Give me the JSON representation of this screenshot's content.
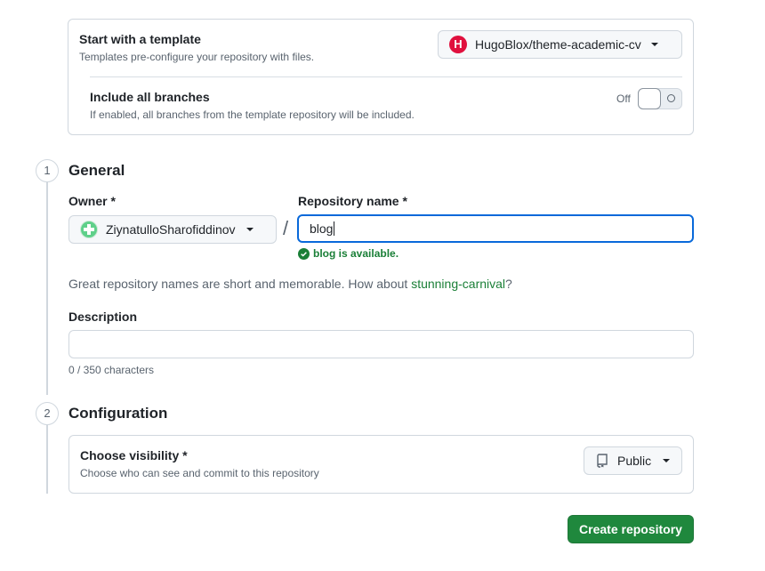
{
  "template": {
    "title": "Start with a template",
    "subtitle": "Templates pre-configure your repository with files.",
    "selected": "HugoBlox/theme-academic-cv",
    "avatar_letter": "H",
    "include_branches_title": "Include all branches",
    "include_branches_subtitle": "If enabled, all branches from the template repository will be included.",
    "toggle_state": "Off"
  },
  "general": {
    "step": "1",
    "title": "General",
    "owner_label": "Owner *",
    "owner_value": "ZiynatulloSharofiddinov",
    "separator": "/",
    "repo_label": "Repository name *",
    "repo_value": "blog",
    "availability": "blog is available.",
    "suggestion_prefix": "Great repository names are short and memorable. How about ",
    "suggestion_name": "stunning-carnival",
    "suggestion_suffix": "?",
    "description_label": "Description",
    "description_value": "",
    "char_count": "0 / 350 characters"
  },
  "configuration": {
    "step": "2",
    "title": "Configuration",
    "visibility_title": "Choose visibility *",
    "visibility_subtitle": "Choose who can see and commit to this repository",
    "visibility_value": "Public"
  },
  "actions": {
    "create_label": "Create repository"
  },
  "colors": {
    "primary_green": "#1f883d",
    "focus_blue": "#0969da",
    "success_green": "#1a7f37",
    "avatar_red": "#e0103e"
  }
}
